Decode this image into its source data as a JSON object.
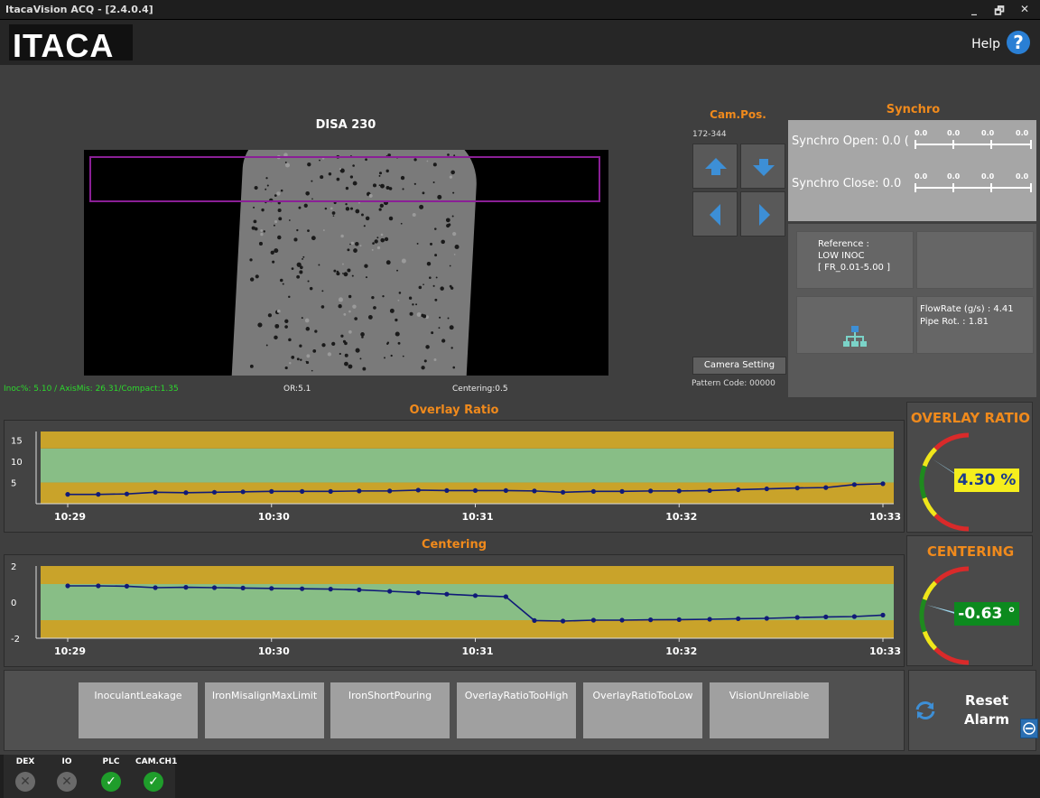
{
  "window": {
    "title": "ItacaVision ACQ - [2.4.0.4]",
    "controls": [
      "_",
      "🗗",
      "✕"
    ]
  },
  "header": {
    "logo_text": "ITACA",
    "help_label": "Help",
    "help_icon": "?"
  },
  "camera": {
    "title": "DISA 230",
    "stats": {
      "inoc": "Inoc%: 5.10 / AxisMis: 26.31/Compact:1.35",
      "or": "OR:5.1",
      "centering": "Centering:0.5"
    }
  },
  "cam_pos": {
    "title": "Cam.Pos.",
    "range": "172-344",
    "camera_setting_label": "Camera Setting",
    "pattern_code": "Pattern Code: 00000"
  },
  "synchro": {
    "title": "Synchro",
    "open_label": "Synchro Open: 0.0 (",
    "close_label": "Synchro Close: 0.0",
    "scale_ticks": [
      "0.0",
      "0.0",
      "0.0",
      "0.0"
    ]
  },
  "info": {
    "reference_lines": [
      "Reference :",
      "LOW INOC",
      "[ FR_0.01-5.00 ]"
    ],
    "flowrate": "FlowRate (g/s) : 4.41",
    "pipe_rot": "Pipe Rot. : 1.81"
  },
  "chart_data": [
    {
      "type": "line",
      "title": "Overlay Ratio",
      "xlabel": "",
      "ylabel": "",
      "x_ticks": [
        "10:29",
        "10:30",
        "10:31",
        "10:32",
        "10:33"
      ],
      "y_ticks": [
        "5",
        "10",
        "15"
      ],
      "ylim": [
        0,
        17
      ],
      "bands": [
        {
          "from": 0,
          "to": 5,
          "color": "#c9a32a"
        },
        {
          "from": 5,
          "to": 13,
          "color": "#88be86"
        },
        {
          "from": 13,
          "to": 17,
          "color": "#c9a32a"
        }
      ],
      "x": [
        0,
        0.15,
        0.29,
        0.43,
        0.58,
        0.72,
        0.86,
        1.0,
        1.15,
        1.29,
        1.43,
        1.58,
        1.72,
        1.86,
        2.0,
        2.15,
        2.29,
        2.43,
        2.58,
        2.72,
        2.86,
        3.0,
        3.15,
        3.29,
        3.43,
        3.58,
        3.72,
        3.86,
        4.0
      ],
      "series": [
        {
          "values": [
            2.2,
            2.2,
            2.3,
            2.7,
            2.6,
            2.7,
            2.8,
            2.9,
            2.9,
            2.9,
            3.0,
            3.0,
            3.2,
            3.1,
            3.1,
            3.1,
            3.0,
            2.7,
            2.9,
            2.9,
            3.0,
            3.0,
            3.1,
            3.3,
            3.5,
            3.7,
            3.8,
            4.5,
            4.7
          ],
          "color": "#101a78"
        }
      ]
    },
    {
      "type": "line",
      "title": "Centering",
      "xlabel": "",
      "ylabel": "",
      "x_ticks": [
        "10:29",
        "10:30",
        "10:31",
        "10:32",
        "10:33"
      ],
      "y_ticks": [
        "-2",
        "0",
        "2"
      ],
      "ylim": [
        -2,
        2
      ],
      "bands": [
        {
          "from": -2,
          "to": -1,
          "color": "#c9a32a"
        },
        {
          "from": -1,
          "to": 1,
          "color": "#88be86"
        },
        {
          "from": 1,
          "to": 2,
          "color": "#c9a32a"
        }
      ],
      "x": [
        0,
        0.15,
        0.29,
        0.43,
        0.58,
        0.72,
        0.86,
        1.0,
        1.15,
        1.29,
        1.43,
        1.58,
        1.72,
        1.86,
        2.0,
        2.15,
        2.29,
        2.43,
        2.58,
        2.72,
        2.86,
        3.0,
        3.15,
        3.29,
        3.43,
        3.58,
        3.72,
        3.86,
        4.0
      ],
      "series": [
        {
          "values": [
            0.9,
            0.9,
            0.88,
            0.8,
            0.82,
            0.8,
            0.78,
            0.76,
            0.74,
            0.72,
            0.68,
            0.6,
            0.52,
            0.44,
            0.36,
            0.3,
            -1.02,
            -1.05,
            -1.0,
            -1.0,
            -0.98,
            -0.97,
            -0.95,
            -0.92,
            -0.9,
            -0.85,
            -0.82,
            -0.8,
            -0.72
          ],
          "color": "#101a78"
        }
      ]
    }
  ],
  "gauges": {
    "overlay": {
      "title": "OVERLAY RATIO",
      "value": "4.30 %",
      "fraction": 0.32,
      "color_bg": "#f5ee1d",
      "color_fg": "#1b3a8a"
    },
    "centering": {
      "title": "CENTERING",
      "value": "-0.63 °",
      "fraction": 0.42,
      "color_bg": "#0c8a1e",
      "color_fg": "#ffffff"
    }
  },
  "alarms": [
    {
      "label": "InoculantLeakage"
    },
    {
      "label": "IronMisalignMaxLimit"
    },
    {
      "label": "IronShortPouring"
    },
    {
      "label": "OverlayRatioTooHigh"
    },
    {
      "label": "OverlayRatioTooLow"
    },
    {
      "label": "VisionUnreliable"
    }
  ],
  "reset": {
    "label_1": "Reset",
    "label_2": "Alarm"
  },
  "status": [
    {
      "label": "DEX",
      "state": "off",
      "glyph": "✕"
    },
    {
      "label": "IO",
      "state": "off",
      "glyph": "✕"
    },
    {
      "label": "PLC",
      "state": "on",
      "glyph": "✓"
    },
    {
      "label": "CAM.CH1",
      "state": "on",
      "glyph": "✓"
    }
  ]
}
